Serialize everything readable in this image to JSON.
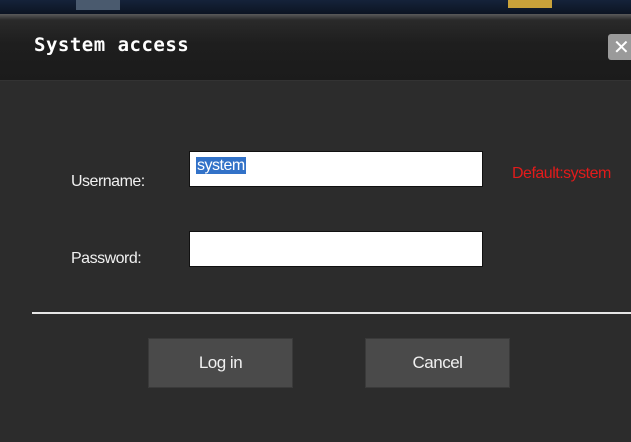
{
  "dialog": {
    "title": "System access",
    "close_glyph": "✕"
  },
  "form": {
    "username_label": "Username:",
    "username_value": "system",
    "username_hint": "Default:system",
    "password_label": "Password:",
    "password_value": ""
  },
  "buttons": {
    "login_label": "Log in",
    "cancel_label": "Cancel"
  },
  "colors": {
    "hint": "#e21b1b",
    "selection": "#3272c8"
  }
}
